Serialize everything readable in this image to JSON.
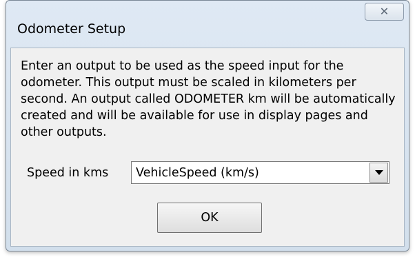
{
  "window": {
    "title": "Odometer Setup",
    "close_icon": "close-icon",
    "close_glyph": "✕"
  },
  "dialog": {
    "description": "Enter an output to be used as the speed input for the odometer. This output must be scaled in kilometers per second. An output called ODOMETER km will be automatically created and will be available for use in display pages and other outputs.",
    "speed_label": "Speed in kms",
    "speed_value": "VehicleSpeed (km/s)",
    "dropdown_icon": "chevron-down-icon",
    "ok_label": "OK"
  },
  "colors": {
    "title_bar": "#d2dfec",
    "client_bg": "#f0f0f0"
  }
}
